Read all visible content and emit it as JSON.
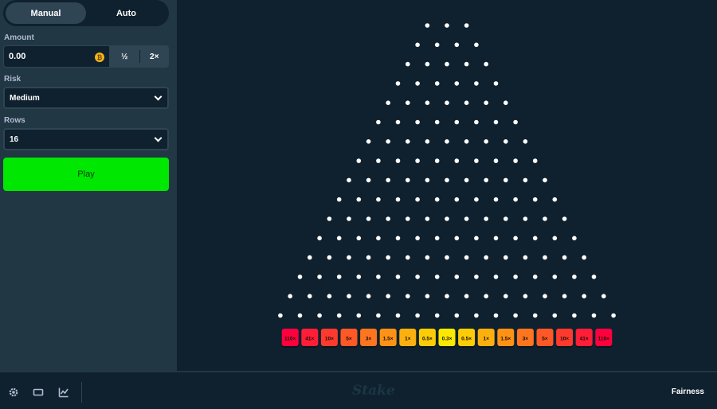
{
  "sidebar": {
    "tabs": [
      {
        "label": "Manual",
        "active": true
      },
      {
        "label": "Auto",
        "active": false
      }
    ],
    "amount": {
      "label": "Amount",
      "value": "0.00",
      "half_label": "½",
      "double_label": "2×",
      "currency_icon": "coin-icon"
    },
    "risk": {
      "label": "Risk",
      "value": "Medium"
    },
    "rows": {
      "label": "Rows",
      "value": "16"
    },
    "play_label": "Play"
  },
  "game": {
    "rows": 16,
    "multipliers": [
      "110×",
      "41×",
      "10×",
      "5×",
      "3×",
      "1.5×",
      "1×",
      "0.5×",
      "0.3×",
      "0.5×",
      "1×",
      "1.5×",
      "3×",
      "5×",
      "10×",
      "41×",
      "110×"
    ],
    "bucket_colors": [
      "#ff003f",
      "#ff1d37",
      "#fe3a2f",
      "#fe5827",
      "#fd751f",
      "#fd9217",
      "#fcb00f",
      "#fccd07",
      "#fbea00",
      "#fccd07",
      "#fcb00f",
      "#fd9217",
      "#fd751f",
      "#fe5827",
      "#fe3a2f",
      "#ff1d37",
      "#ff003f"
    ],
    "peg_color": "#ffffff"
  },
  "footer": {
    "icons": [
      "settings-icon",
      "theatre-mode-icon",
      "stats-icon"
    ],
    "logo": "Stake",
    "fairness_label": "Fairness"
  },
  "colors": {
    "background": "#0f212e",
    "sidebar": "#213743",
    "control": "#2f4553",
    "play": "#00e701"
  }
}
